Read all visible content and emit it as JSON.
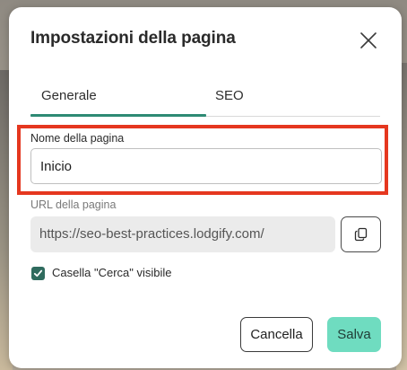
{
  "dialog": {
    "title": "Impostazioni della pagina",
    "close_icon": "close-icon"
  },
  "tabs": [
    {
      "label": "Generale",
      "active": true
    },
    {
      "label": "SEO",
      "active": false
    }
  ],
  "page_name": {
    "label": "Nome della pagina",
    "value": "Inicio"
  },
  "page_url": {
    "label": "URL della pagina",
    "value": "https://seo-best-practices.lodgify.com/",
    "copy_icon": "copy-icon"
  },
  "search_box": {
    "label": "Casella \"Cerca\" visibile",
    "checked": true
  },
  "actions": {
    "cancel_label": "Cancella",
    "save_label": "Salva"
  },
  "colors": {
    "accent": "#2e8a74",
    "save_button": "#6fdcc0",
    "checkbox": "#2f6b5e",
    "highlight": "#e5371f"
  }
}
